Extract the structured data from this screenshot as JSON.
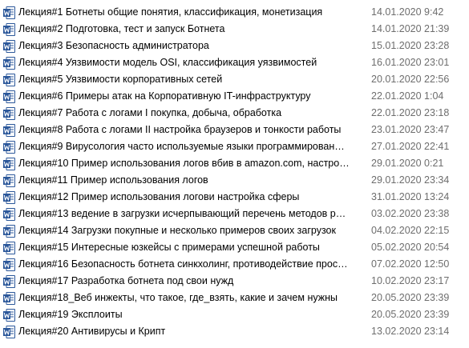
{
  "files": [
    {
      "name": "Лекция#1 Ботнеты общие понятия, классификация, монетизация",
      "modified": "14.01.2020 9:42",
      "icon": "word-document-icon"
    },
    {
      "name": "Лекция#2 Подготовка, тест и запуск Ботнета",
      "modified": "14.01.2020 21:39",
      "icon": "word-document-icon"
    },
    {
      "name": "Лекция#3 Безопасность администратора",
      "modified": "15.01.2020 23:28",
      "icon": "word-document-icon"
    },
    {
      "name": "Лекция#4 Уязвимости модель OSI, классификация уязвимостей",
      "modified": "16.01.2020 23:01",
      "icon": "word-document-icon"
    },
    {
      "name": "Лекция#5  Уязвимости корпоративных сетей",
      "modified": "20.01.2020 22:56",
      "icon": "word-document-icon"
    },
    {
      "name": "Лекция#6  Примеры атак на Корпоративную IT-инфраструктуру",
      "modified": "22.01.2020 1:04",
      "icon": "word-document-icon"
    },
    {
      "name": "Лекция#7  Работа с логами I покупка, добыча, обработка",
      "modified": "22.01.2020 23:18",
      "icon": "word-document-icon"
    },
    {
      "name": "Лекция#8  Работа с логами II настройка браузеров и тонкости работы",
      "modified": "23.01.2020 23:47",
      "icon": "word-document-icon"
    },
    {
      "name": "Лекция#9  Вирусология часто используемые языки программирования, к...",
      "modified": "27.01.2020 22:41",
      "icon": "word-document-icon"
    },
    {
      "name": "Лекция#10  Пример использования логов вбив в amazon.com, настройка ...",
      "modified": "29.01.2020 0:21",
      "icon": "word-document-icon"
    },
    {
      "name": "Лекция#11 Пример использования логов",
      "modified": "29.01.2020 23:34",
      "icon": "word-document-icon"
    },
    {
      "name": "Лекция#12 Пример использования логови настройка сферы",
      "modified": "31.01.2020 13:24",
      "icon": "word-document-icon"
    },
    {
      "name": "Лекция#13 ведение в загрузки исчерпывающий перечень методов распр...",
      "modified": "03.02.2020 23:38",
      "icon": "word-document-icon"
    },
    {
      "name": "Лекция#14 Загрузки покупные и несколько примеров своих загрузок",
      "modified": "04.02.2020 22:15",
      "icon": "word-document-icon"
    },
    {
      "name": "Лекция#15 Интересные юзкейсы с примерами успешной работы",
      "modified": "05.02.2020 20:54",
      "icon": "word-document-icon"
    },
    {
      "name": "Лекция#16 Безопасность ботнета синкхолинг, противодействие прослуш...",
      "modified": "07.02.2020 12:50",
      "icon": "word-document-icon"
    },
    {
      "name": "Лекция#17 Разработка ботнета под свои нужд",
      "modified": "10.02.2020 23:17",
      "icon": "word-document-icon"
    },
    {
      "name": "Лекция#18_Веб инжекты, что такое, где_взять, какие и зачем нужны",
      "modified": "20.05.2020 23:39",
      "icon": "word-document-icon"
    },
    {
      "name": "Лекция#19 Эксплоиты",
      "modified": "20.05.2020 23:39",
      "icon": "word-document-icon"
    },
    {
      "name": "Лекция#20 Антивирусы и Крипт",
      "modified": "13.02.2020 23:14",
      "icon": "word-document-icon"
    }
  ],
  "colors": {
    "word_blue": "#2b579a",
    "word_blue_light": "#41a5ee",
    "date_text": "#6d6d6d"
  }
}
